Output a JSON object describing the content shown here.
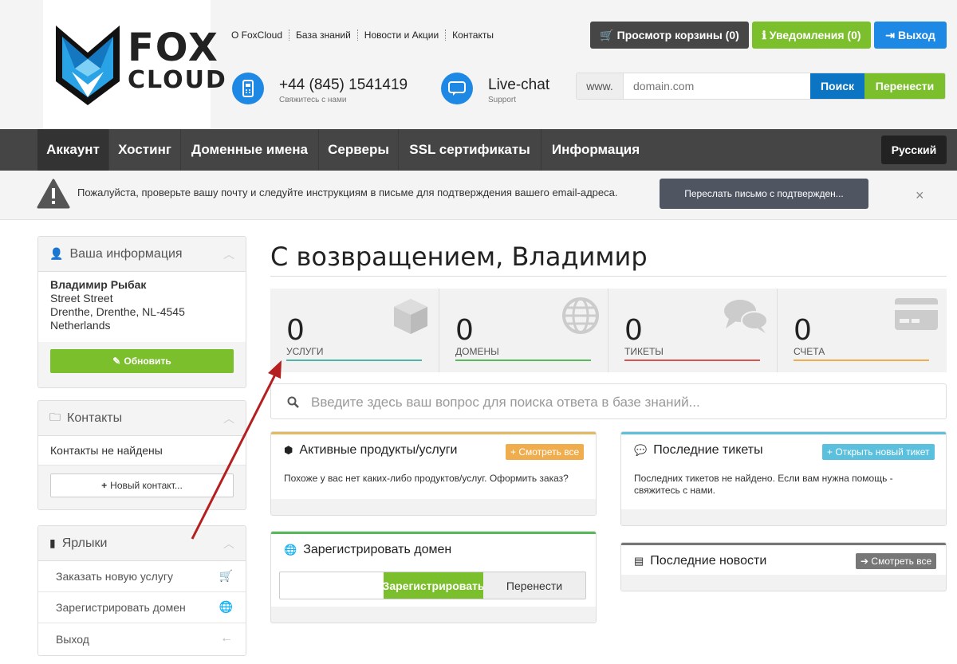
{
  "header": {
    "logo_line1": "FOX",
    "logo_line2": "CLOUD",
    "top_links": [
      "О FoxCloud",
      "База знаний",
      "Новости и Акции",
      "Контакты"
    ],
    "phone": "+44 (845) 1541419",
    "phone_sub": "Свяжитесь с нами",
    "chat": "Live-chat",
    "chat_sub": "Support",
    "cart_button": "Просмотр корзины (0)",
    "notifications_button": "Уведомления (0)",
    "logout_button": "Выход",
    "domain_prefix": "www.",
    "domain_placeholder": "domain.com",
    "search_button": "Поиск",
    "transfer_button": "Перенести"
  },
  "nav": {
    "items": [
      "Аккаунт",
      "Хостинг",
      "Доменные имена",
      "Серверы",
      "SSL сертификаты",
      "Информация"
    ],
    "language": "Русский"
  },
  "alert": {
    "text": "Пожалуйста, проверьте вашу почту и следуйте инструкциям в письме для подтверждения вашего email-адреса.",
    "button": "Переслать письмо с подтвержден...",
    "close": "×"
  },
  "sidebar": {
    "info_title": "Ваша информация",
    "name": "Владимир Рыбак",
    "address1": "Street Street",
    "address2": "Drenthe, Drenthe, NL-4545",
    "country": "Netherlands",
    "update_button": "Обновить",
    "contacts_title": "Контакты",
    "no_contacts": "Контакты не найдены",
    "new_contact_button": "Новый контакт...",
    "shortcuts_title": "Ярлыки",
    "shortcuts": [
      "Заказать новую услугу",
      "Зарегистрировать домен",
      "Выход"
    ]
  },
  "main": {
    "welcome": "С возвращением, Владимир",
    "stats": [
      {
        "value": "0",
        "label": "УСЛУГИ",
        "color": "#4db6ac"
      },
      {
        "value": "0",
        "label": "ДОМЕНЫ",
        "color": "#5cb85c"
      },
      {
        "value": "0",
        "label": "ТИКЕТЫ",
        "color": "#d9534f"
      },
      {
        "value": "0",
        "label": "СЧЕТА",
        "color": "#f0ad4e"
      }
    ],
    "kb_placeholder": "Введите здесь ваш вопрос для поиска ответа в базе знаний...",
    "products_title": "Активные продукты/услуги",
    "products_badge": "Смотреть все",
    "products_text": "Похоже у вас нет каких-либо продуктов/услуг.",
    "products_link": "Оформить заказ?",
    "tickets_title": "Последние тикеты",
    "tickets_badge": "Открыть новый тикет",
    "tickets_text": "Последних тикетов не найдено. Если вам нужна помощь -",
    "tickets_link": "свяжитесь с нами.",
    "register_title": "Зарегистрировать домен",
    "register_button": "Зарегистрировать",
    "register_transfer": "Перенести",
    "news_title": "Последние новости",
    "news_badge": "Смотреть все"
  }
}
